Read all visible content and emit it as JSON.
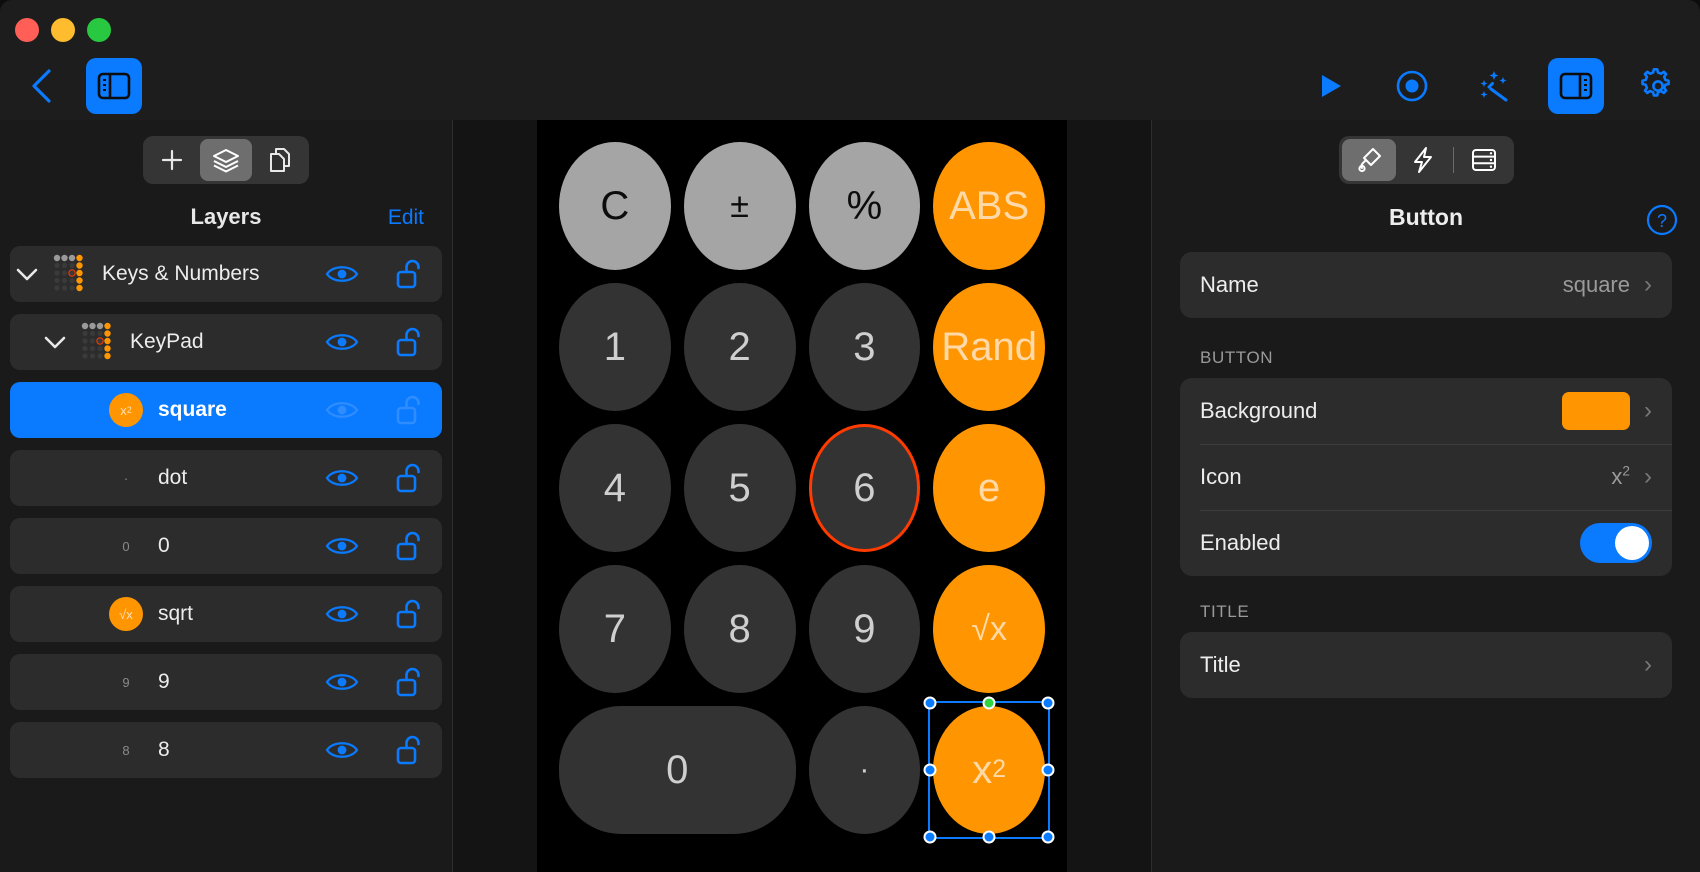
{
  "window": {
    "traffic_lights": [
      "close",
      "minimize",
      "zoom"
    ],
    "colors": {
      "accent_blue": "#0a7aff",
      "accent_orange": "#ff9500",
      "selection_ring_red": "#ff3b00",
      "rotate_handle_green": "#30d43f",
      "panel_bg": "#1a1a1a",
      "row_bg": "#2c2c2c",
      "canvas_bg": "#000000"
    }
  },
  "toolbar": {
    "back_icon": "chevron-left-icon",
    "left_sidebar_toggle_icon": "left-sidebar-icon",
    "right_items": [
      {
        "icon": "play-icon",
        "name": "play-button",
        "active": false
      },
      {
        "icon": "record-icon",
        "name": "record-button",
        "active": false
      },
      {
        "icon": "magic-wand-icon",
        "name": "magic-button",
        "active": false
      },
      {
        "icon": "right-sidebar-icon",
        "name": "inspector-toggle",
        "active": true
      },
      {
        "icon": "gear-icon",
        "name": "settings-button",
        "active": false
      }
    ]
  },
  "left_panel": {
    "segmented": [
      {
        "icon": "plus-icon",
        "name": "add-layer-tab",
        "active": false
      },
      {
        "icon": "layers-icon",
        "name": "layers-tab",
        "active": true
      },
      {
        "icon": "copy-pages-icon",
        "name": "pages-tab",
        "active": false
      }
    ],
    "title": "Layers",
    "edit_label": "Edit",
    "rows": [
      {
        "name": "Keys & Numbers",
        "indent": 0,
        "expanded": true,
        "chevron": "chevron-down-icon",
        "thumb": "keypad-thumb",
        "badge": null,
        "visible": true,
        "locked": false,
        "selected": false
      },
      {
        "name": "KeyPad",
        "indent": 1,
        "expanded": true,
        "chevron": "chevron-down-icon",
        "thumb": "keypad-thumb",
        "badge": null,
        "visible": true,
        "locked": false,
        "selected": false
      },
      {
        "name": "square",
        "indent": 2,
        "expanded": false,
        "chevron": null,
        "thumb": "orange-circle",
        "badge": "x2",
        "visible": true,
        "locked": false,
        "selected": true
      },
      {
        "name": "dot",
        "indent": 2,
        "expanded": false,
        "chevron": null,
        "thumb": "dot-glyph",
        "badge": null,
        "visible": true,
        "locked": false,
        "selected": false
      },
      {
        "name": "0",
        "indent": 2,
        "expanded": false,
        "chevron": null,
        "thumb": "zero-glyph",
        "badge": null,
        "visible": true,
        "locked": false,
        "selected": false
      },
      {
        "name": "sqrt",
        "indent": 2,
        "expanded": false,
        "chevron": null,
        "thumb": "orange-circle",
        "badge": "sqrtx",
        "visible": true,
        "locked": false,
        "selected": false
      },
      {
        "name": "9",
        "indent": 2,
        "expanded": false,
        "chevron": null,
        "thumb": "nine-glyph",
        "badge": null,
        "visible": true,
        "locked": false,
        "selected": false
      },
      {
        "name": "8",
        "indent": 2,
        "expanded": false,
        "chevron": null,
        "thumb": "eight-glyph",
        "badge": null,
        "visible": true,
        "locked": false,
        "selected": false
      }
    ]
  },
  "canvas": {
    "keys": [
      {
        "label": "C",
        "style": "gray",
        "name": "key-clear"
      },
      {
        "label": "+/-",
        "style": "gray",
        "name": "key-sign"
      },
      {
        "label": "%",
        "style": "gray",
        "name": "key-percent"
      },
      {
        "label": "ABS",
        "style": "orange",
        "name": "key-abs"
      },
      {
        "label": "1",
        "style": "dark",
        "name": "key-1"
      },
      {
        "label": "2",
        "style": "dark",
        "name": "key-2"
      },
      {
        "label": "3",
        "style": "dark",
        "name": "key-3"
      },
      {
        "label": "Rand",
        "style": "orange",
        "name": "key-rand"
      },
      {
        "label": "4",
        "style": "dark",
        "name": "key-4"
      },
      {
        "label": "5",
        "style": "dark",
        "name": "key-5"
      },
      {
        "label": "6",
        "style": "dark",
        "name": "key-6",
        "ring": true
      },
      {
        "label": "e",
        "style": "orange",
        "name": "key-e"
      },
      {
        "label": "7",
        "style": "dark",
        "name": "key-7"
      },
      {
        "label": "8",
        "style": "dark",
        "name": "key-8"
      },
      {
        "label": "9",
        "style": "dark",
        "name": "key-9"
      },
      {
        "label": "√x",
        "style": "orange",
        "name": "key-sqrt"
      },
      {
        "label": "0",
        "style": "dark",
        "name": "key-0",
        "wide": true
      },
      {
        "label": "·",
        "style": "dark",
        "name": "key-dot"
      },
      {
        "label": "x²",
        "style": "orange",
        "name": "key-square",
        "selected": true
      }
    ]
  },
  "inspector": {
    "segmented": [
      {
        "icon": "paintbrush-icon",
        "name": "style-tab",
        "active": true
      },
      {
        "icon": "bolt-icon",
        "name": "actions-tab",
        "active": false
      },
      {
        "icon": "data-stack-icon",
        "name": "data-tab",
        "active": false
      }
    ],
    "title": "Button",
    "help_icon": "question-mark-icon",
    "name_row": {
      "label": "Name",
      "value": "square"
    },
    "sections": [
      {
        "heading": "BUTTON",
        "rows": [
          {
            "label": "Background",
            "value": "",
            "control": "color-swatch",
            "color": "#ff9500"
          },
          {
            "label": "Icon",
            "value": "x²",
            "control": "chevron"
          },
          {
            "label": "Enabled",
            "value": "",
            "control": "toggle",
            "on": true
          }
        ]
      },
      {
        "heading": "TITLE",
        "rows": [
          {
            "label": "Title",
            "value": "",
            "control": "chevron"
          }
        ]
      }
    ]
  }
}
